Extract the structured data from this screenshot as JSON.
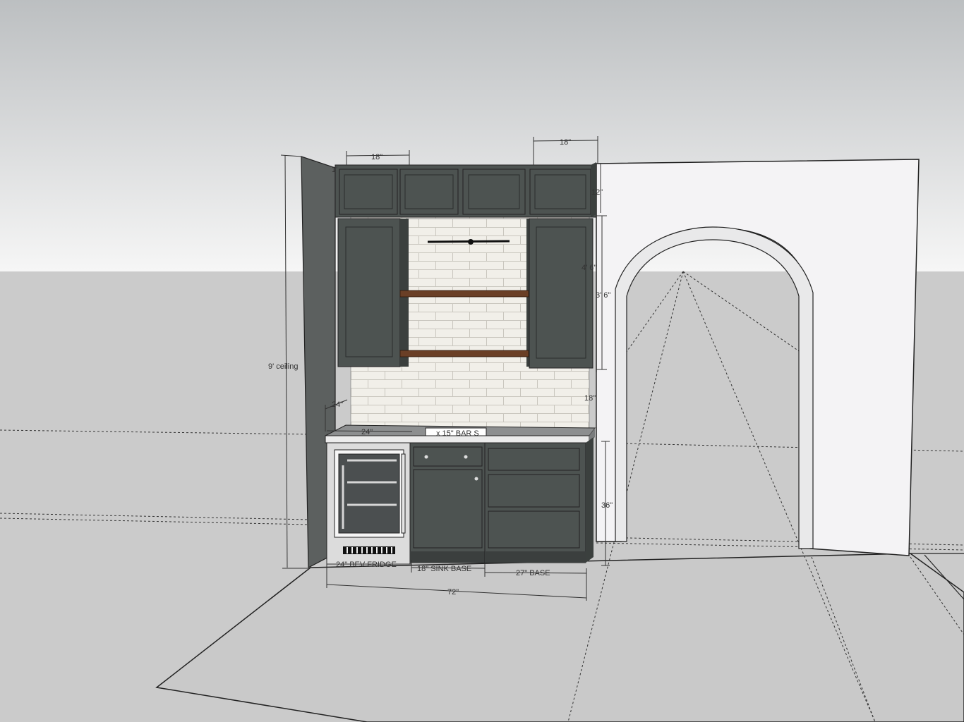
{
  "colors": {
    "sky_top": "#bcbfc1",
    "sky_bottom": "#f6f6f6",
    "ground": "#cbcbcb",
    "cabinet": "#4d5351",
    "cabinet_dark": "#3b403e",
    "tile": "#f1efe9",
    "wood_shelf": "#6a3f26",
    "wall": "#f4f3f5",
    "side_wall": "#5c605f",
    "steel": "#dcdcdc"
  },
  "icons": [
    "wine-fridge-icon",
    "drawer-knob-icon",
    "bar-sink-icon",
    "shelf-bracket-icon"
  ],
  "labels": {
    "ceiling": "9' ceiling",
    "upper_width_left": "18\"",
    "upper_width_right": "18\"",
    "upper_height": "12\"",
    "tall_height_a": "4' 6\"",
    "tall_height_b": "3' 6\"",
    "backsplash_height": "18\"",
    "counter_depth": "24\"",
    "counter_width": "24\"",
    "sink": "x 15\" BAR S",
    "base_height": "36\"",
    "fridge": "24\" BEV FRIDGE",
    "sink_base": "18\" SINK BASE",
    "base_27": "27\" BASE",
    "total": "72\"",
    "corner_mark": "1'"
  }
}
